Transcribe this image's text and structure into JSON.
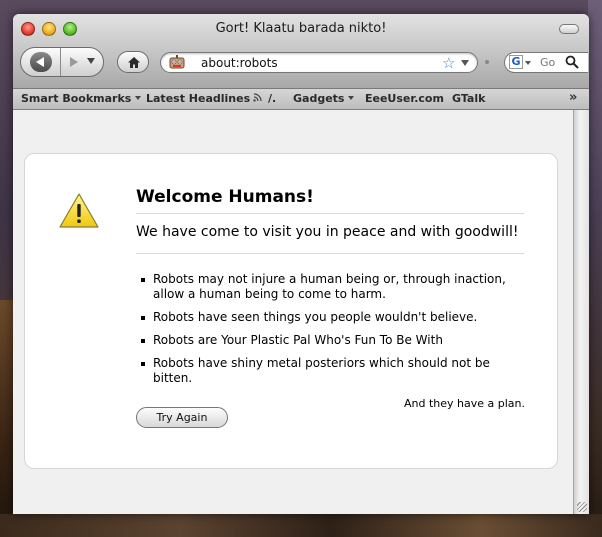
{
  "window": {
    "title": "Gort! Klaatu barada nikto!"
  },
  "toolbar": {
    "address": "about:robots",
    "search_placeholder": "Go",
    "search_engine_letter": "G"
  },
  "bookmarks": [
    {
      "label": "Smart Bookmarks",
      "dropdown": true
    },
    {
      "label": "Latest Headlines",
      "feed": true
    },
    {
      "label": "/."
    },
    {
      "label": "Gadgets",
      "dropdown": true
    },
    {
      "label": "EeeUser.com"
    },
    {
      "label": "GTalk"
    }
  ],
  "page": {
    "title": "Welcome Humans!",
    "subtitle": "We have come to visit you in peace and with goodwill!",
    "laws": [
      "Robots may not injure a human being or, through inaction, allow a human being to come to harm.",
      "Robots have seen things you people wouldn't believe.",
      "Robots are Your Plastic Pal Who's Fun To Be With",
      "Robots have shiny metal posteriors which should not be bitten."
    ],
    "tagline": "And they have a plan.",
    "button": "Try Again"
  },
  "colors": {
    "accent_blue": "#4a7fd0",
    "warning_yellow": "#f5d21a"
  }
}
